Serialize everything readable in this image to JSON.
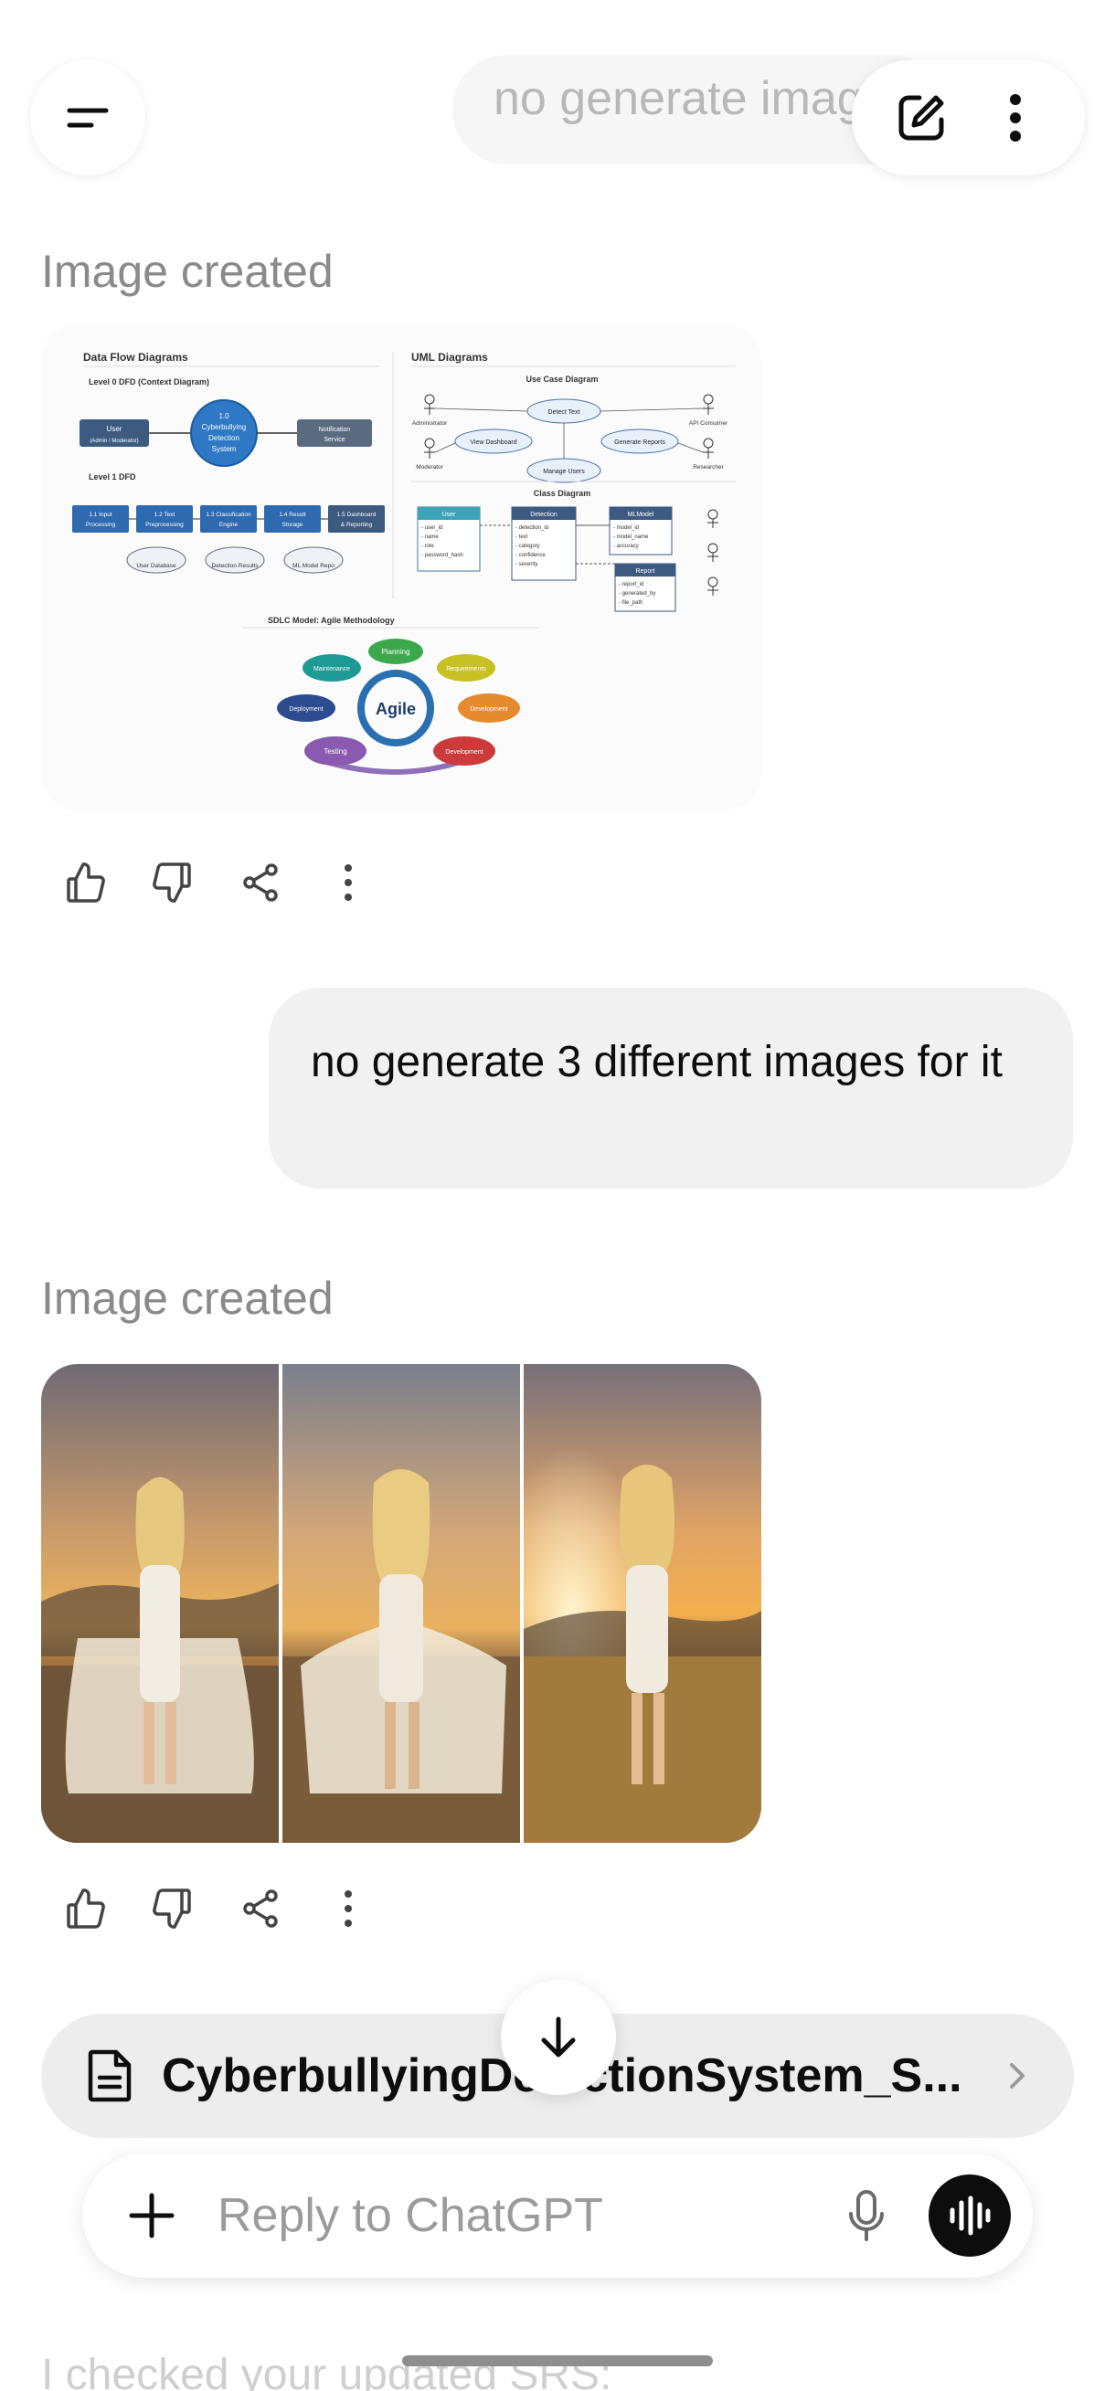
{
  "header": {
    "title": "no generate images",
    "icons": {
      "menu": "menu-icon",
      "new_chat": "edit-icon",
      "more": "more-vertical-icon"
    }
  },
  "messages": [
    {
      "role": "assistant",
      "label": "Image created",
      "diagram": {
        "dfd_title": "Data Flow Diagrams",
        "level0": "Level 0 DFD (Context Diagram)",
        "user_box": "User",
        "user_sub": "(Admin / Moderator)",
        "system_circle": [
          "1.0",
          "Cyberbullying",
          "Detection",
          "System"
        ],
        "notification_box": [
          "Notification",
          "Service"
        ],
        "level1": "Level 1 DFD",
        "processes": [
          [
            "1.1 Input",
            "Processing"
          ],
          [
            "1.2 Text",
            "Preprocessing"
          ],
          [
            "1.3 Classification",
            "Engine"
          ],
          [
            "1.4 Result",
            "Storage"
          ],
          [
            "1.5 Dashboard",
            "& Reporting"
          ]
        ],
        "datastores": [
          "User Database",
          "Detection Results",
          "ML Model Repo"
        ],
        "uml_title": "UML Diagrams",
        "usecase_title": "Use Case Diagram",
        "actors": [
          "Administrator",
          "Moderator",
          "API Consumer",
          "Researcher"
        ],
        "usecases": [
          "Detect Text",
          "View Dashboard",
          "Generate Reports",
          "Manage Users"
        ],
        "class_title": "Class Diagram",
        "classes": [
          {
            "name": "User",
            "fields": [
              "- user_id",
              "- name",
              "- role",
              "- password_hash"
            ]
          },
          {
            "name": "Detection",
            "fields": [
              "- detection_id",
              "- text",
              "- category",
              "- confidence",
              "- severity"
            ]
          },
          {
            "name": "MLModel",
            "fields": [
              "- model_id",
              "- model_name",
              "- accuracy"
            ]
          },
          {
            "name": "Report",
            "fields": [
              "- report_id",
              "- generated_by",
              "- file_path"
            ]
          }
        ],
        "sdlc_title": "SDLC Model: Agile Methodology",
        "agile_center": "Agile",
        "agile_phases": [
          "Planning",
          "Requirements",
          "Development",
          "Development",
          "Testing",
          "Deployment",
          "Maintenance"
        ]
      }
    },
    {
      "role": "user",
      "text": "no generate 3 different images for it"
    },
    {
      "role": "assistant",
      "label": "Image created",
      "photos_count": 3
    }
  ],
  "reaction_icons": [
    "thumbs-up-icon",
    "thumbs-down-icon",
    "share-icon",
    "more-vertical-icon"
  ],
  "file": {
    "name": "CyberbullyingDetectionSystem_S...",
    "icon": "document-icon"
  },
  "composer": {
    "placeholder": "Reply to ChatGPT",
    "icons": [
      "plus-icon",
      "microphone-icon",
      "voice-mode-icon"
    ]
  },
  "next_message_preview": "I checked your updated SRS:"
}
